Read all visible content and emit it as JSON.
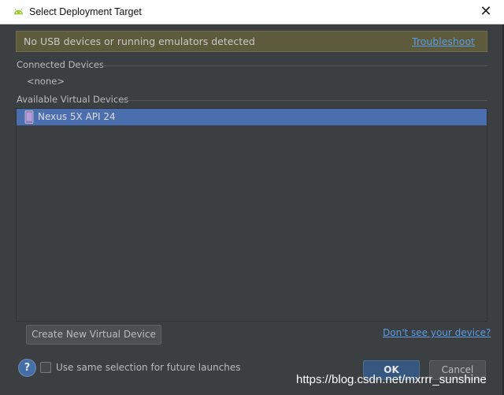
{
  "window": {
    "title": "Select Deployment Target",
    "close_glyph": "✕",
    "icon": "android-icon"
  },
  "banner": {
    "message": "No USB devices or running emulators detected",
    "link": "Troubleshoot"
  },
  "connected": {
    "heading": "Connected Devices",
    "empty": "<none>"
  },
  "virtual": {
    "heading": "Available Virtual Devices",
    "devices": [
      {
        "label": "Nexus 5X API 24",
        "icon": "phone-icon",
        "selected": true
      }
    ]
  },
  "buttons": {
    "create": "Create New Virtual Device",
    "ok": "OK",
    "cancel": "Cancel",
    "help_glyph": "?"
  },
  "links": {
    "dont_see": "Don't see your device?"
  },
  "options": {
    "same_selection": "Use same selection for future launches",
    "same_selection_checked": false
  },
  "watermark": "https://blog.csdn.net/mxrrr_sunshine",
  "colors": {
    "background": "#3c3f41",
    "selection": "#4b6eaf",
    "banner": "#5d5b3c",
    "link": "#5a9be3",
    "android_green": "#a4c639"
  }
}
